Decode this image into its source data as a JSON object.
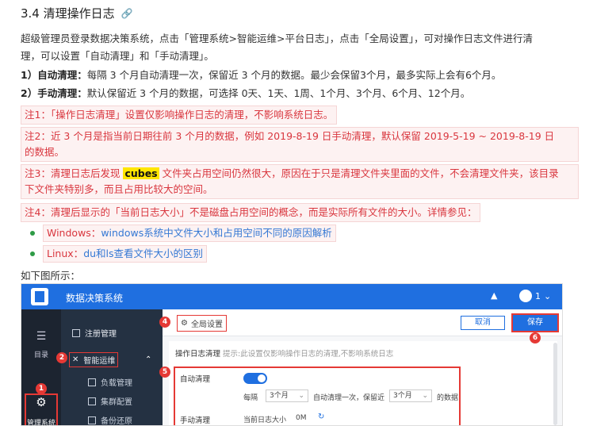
{
  "section": {
    "number_title": "3.4 清理操作日志"
  },
  "intro": {
    "text_a": "超级管理员登录数据决策系统，点击「管理系统>智能运维>平台日志」，点击「全局设置」，可对操作日志文件进行清",
    "text_b": "理，可以设置「自动清理」和「手动清理」。"
  },
  "modes": [
    {
      "label": "1）自动清理：",
      "text": "每隔 3 个月自动清理一次，保留近 3 个月的数据。最少会保留3个月，最多实际上会有6个月。"
    },
    {
      "label": "2）手动清理：",
      "text": "默认保留近 3 个月的数据，可选择 0天、1天、1周、1个月、3个月、6个月、12个月。"
    }
  ],
  "notes": {
    "n1": "注1：「操作日志清理」设置仅影响操作日志的清理，不影响系统日志。",
    "n2_a": "注2：近 3 个月是指当前日期往前 3 个月的数据，例如 2019-8-19 日手动清理，默认保留 2019-5-19 ~ 2019-8-19 日",
    "n2_b": "的数据。",
    "n3_pre": "注3：清理日志后发现 ",
    "n3_hl": "cubes",
    "n3_post": " 文件夹占用空间仍然很大，原因在于只是清理文件夹里面的文件，不会清理文件夹，该目录",
    "n3_b": "下文件夹特别多，而且占用比较大的空间。",
    "n4": "注4：清理后显示的「当前日志大小」不是磁盘占用空间的概念，而是实际所有文件的大小。详情参见："
  },
  "links": [
    {
      "prefix": "Windows：",
      "text": "windows系统中文件大小和占用空间不同的原因解析"
    },
    {
      "prefix": "Linux：",
      "text": "du和ls查看文件大小的区别"
    }
  ],
  "caption": "如下图所示：",
  "screenshot": {
    "app_title": "数据决策系统",
    "user_label": "1",
    "rail": [
      {
        "label": "目录"
      },
      {
        "label": "管理系统"
      }
    ],
    "sidebar": [
      {
        "label": "注册管理"
      },
      {
        "label": "智能运维"
      },
      {
        "label": "负载管理"
      },
      {
        "label": "集群配置"
      },
      {
        "label": "备份还原"
      }
    ],
    "tab_label": "全局设置",
    "cancel_label": "取消",
    "save_label": "保存",
    "panel_title": "操作日志清理",
    "panel_hint": "提示:此设置仅影响操作日志的清理,不影响系统日志",
    "auto_label": "自动清理",
    "every_label": "每隔",
    "every_value": "3个月",
    "mid_text": "自动清理一次，保留近",
    "keep_value": "3个月",
    "tail_text": "的数据",
    "manual_label": "手动清理",
    "size_label": "当前日志大小",
    "size_value": "0M",
    "badges": [
      "1",
      "2",
      "4",
      "5",
      "6"
    ]
  },
  "colors": {
    "accent": "#1f6fe0",
    "note_red": "#d9363e",
    "highlight": "#ffe600"
  }
}
